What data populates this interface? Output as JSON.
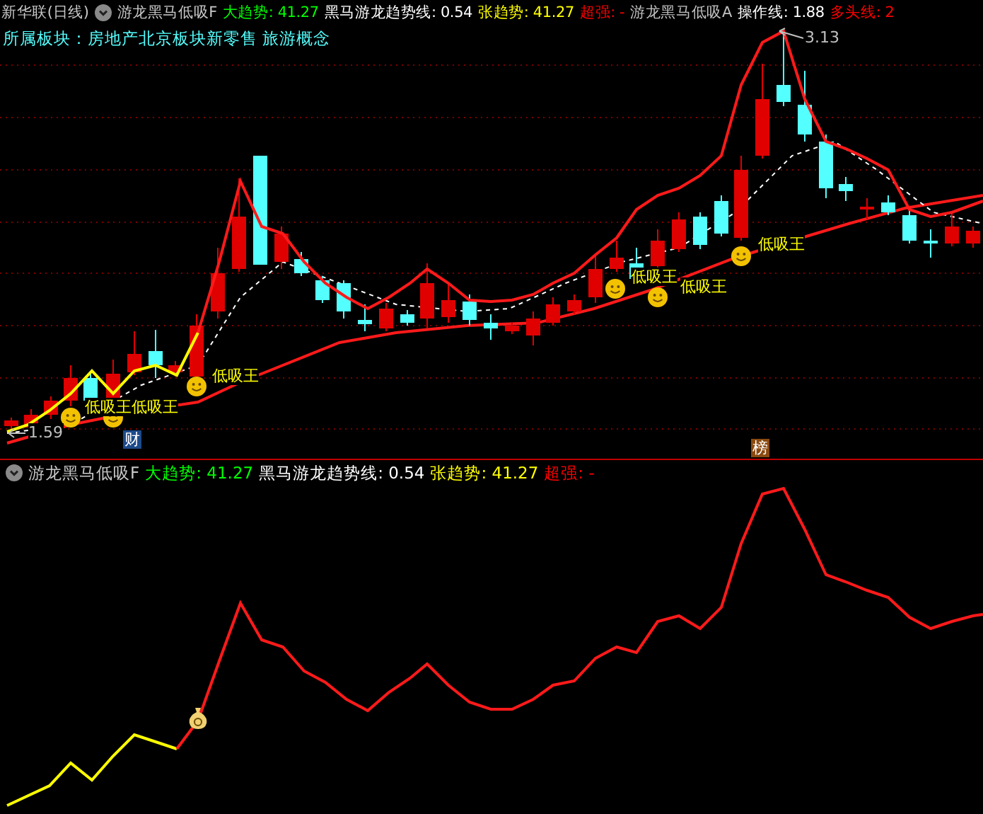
{
  "title": "新华联(日线)",
  "top_panel": {
    "indicator": "游龙黑马低吸F",
    "readouts": [
      {
        "text": "大趋势: 41.27",
        "color": "#00ff00"
      },
      {
        "text": "黑马游龙趋势线: 0.54",
        "color": "#ffffff"
      },
      {
        "text": "张趋势: 41.27",
        "color": "#ffff00"
      },
      {
        "text": "超强: -",
        "color": "#ff0000"
      },
      {
        "text": "游龙黑马低吸A",
        "color": "#c0c0c0"
      },
      {
        "text": "操作线: 1.88",
        "color": "#ffffff"
      },
      {
        "text": "多头线: 2",
        "color": "#ff0000"
      }
    ],
    "sector": "所属板块：房地产北京板块新零售 旅游概念",
    "high_mark": "3.13",
    "low_mark": "1.59",
    "signals": [
      "低吸王",
      "低吸王",
      "低吸王",
      "低吸王",
      "低吸王",
      "低吸王"
    ],
    "badges": [
      {
        "text": "财",
        "color": "#1c4a8a"
      },
      {
        "text": "榜",
        "color": "#8a4a10"
      }
    ]
  },
  "bottom_panel": {
    "indicator": "游龙黑马低吸F",
    "readouts": [
      {
        "text": "大趋势: 41.27",
        "color": "#00ff00"
      },
      {
        "text": "黑马游龙趋势线: 0.54",
        "color": "#ffffff"
      },
      {
        "text": "张趋势: 41.27",
        "color": "#ffff00"
      },
      {
        "text": "超强: -",
        "color": "#ff0000"
      }
    ]
  }
}
